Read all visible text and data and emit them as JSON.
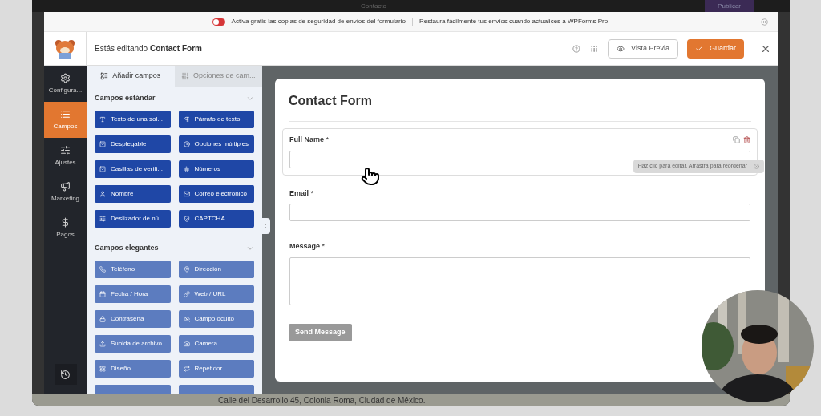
{
  "wp_bar": {
    "title": "Contacto",
    "publish": "Publicar"
  },
  "notice": {
    "toggle_on": false,
    "text": "Activa gratis las copias de seguridad de envíos del formulario",
    "upgrade": "Restaura fácilmente tus envíos cuando actualices a WPForms Pro."
  },
  "header": {
    "editing_prefix": "Estás editando",
    "form_name": "Contact Form",
    "preview": "Vista Previa",
    "save": "Guardar"
  },
  "nav": [
    {
      "label": "Configura...",
      "selected": false
    },
    {
      "label": "Campos",
      "selected": true
    },
    {
      "label": "Ajustes",
      "selected": false
    },
    {
      "label": "Marketing",
      "selected": false
    },
    {
      "label": "Pagos",
      "selected": false
    }
  ],
  "panel_tabs": [
    {
      "label": "Añadir campos",
      "selected": true
    },
    {
      "label": "Opciones de cam...",
      "selected": false
    }
  ],
  "groups": [
    {
      "title": "Campos estándar",
      "kind": "standard",
      "fields": [
        "Texto de una sol...",
        "Párrafo de texto",
        "Desplegable",
        "Opciones múltiples",
        "Casillas de verifi...",
        "Números",
        "Nombre",
        "Correo electrónico",
        "Deslizador de nú...",
        "CAPTCHA"
      ]
    },
    {
      "title": "Campos elegantes",
      "kind": "fancy",
      "fields": [
        "Teléfono",
        "Dirección",
        "Fecha / Hora",
        "Web / URL",
        "Contraseña",
        "Campo oculto",
        "Subida de archivo",
        "Camera",
        "Diseño",
        "Repetidor"
      ]
    }
  ],
  "form": {
    "title": "Contact Form",
    "fields": [
      {
        "label": "Full Name",
        "mark": "*",
        "kind": "text",
        "hovered": true
      },
      {
        "label": "Email",
        "mark": "*",
        "kind": "text",
        "hovered": false
      },
      {
        "label": "Message",
        "mark": "*",
        "kind": "textarea",
        "hovered": false
      }
    ],
    "tooltip": "Haz clic para editar. Arrastra para reordenar",
    "submit": "Send Message"
  },
  "footer_text": "Calle del Desarrollo 45, Colonia Roma, Ciudad de México."
}
